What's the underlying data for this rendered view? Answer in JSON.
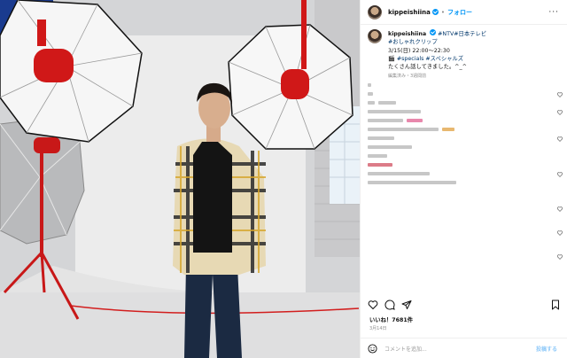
{
  "post": {
    "username": "kippeishiina",
    "follow_label": "フォロー",
    "dot": "•",
    "more_label": "···",
    "caption": {
      "tags_line1": "#NTV#日本テレビ",
      "tags_line2": "#おしゃれクリップ",
      "line3": "3/15(日) 22:00〜22:30",
      "line4_icon": "🎬",
      "line4": "#specials #スペシャルズ",
      "line5": "たくさん話してきました。^_^"
    },
    "meta": "編集済み・3週間前",
    "likes": "いいね！7681件",
    "date": "3月14日",
    "add_comment_placeholder": "コメントを追加...",
    "post_button": "投稿する"
  },
  "colors": {
    "accent": "#0095f6",
    "tag": "#00376b"
  },
  "icons": {
    "header_more": "more-icon",
    "like": "heart-icon",
    "comment": "comment-icon",
    "share": "share-icon",
    "save": "bookmark-icon",
    "emoji": "emoji-icon"
  }
}
